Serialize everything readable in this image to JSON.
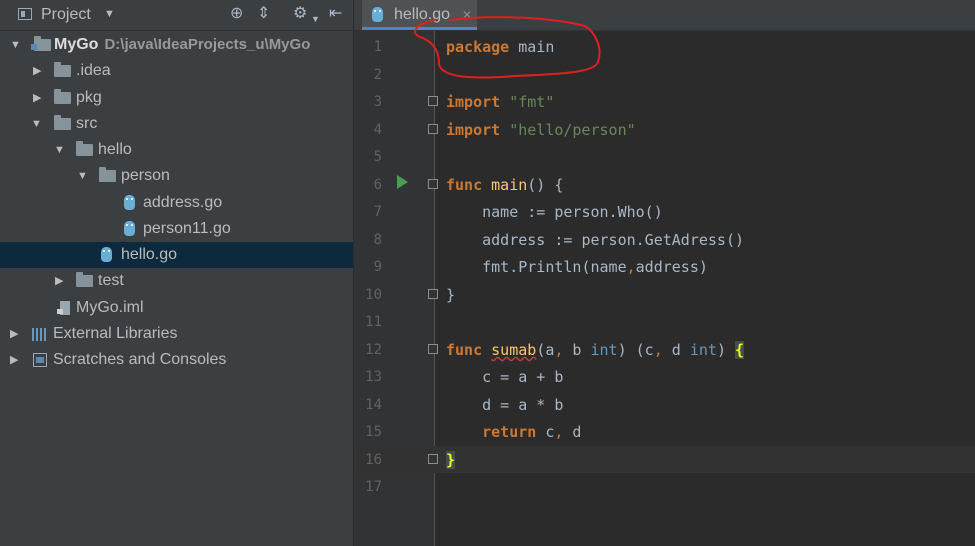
{
  "project_panel": {
    "title": "Project",
    "tree": [
      {
        "name": "MyGo",
        "path": "D:\\java\\IdeaProjects_u\\MyGo"
      },
      {
        "name": ".idea"
      },
      {
        "name": "pkg"
      },
      {
        "name": "src"
      },
      {
        "name": "hello"
      },
      {
        "name": "person"
      },
      {
        "name": "address.go"
      },
      {
        "name": "person11.go"
      },
      {
        "name": "hello.go"
      },
      {
        "name": "test"
      },
      {
        "name": "MyGo.iml"
      },
      {
        "name": "External Libraries"
      },
      {
        "name": "Scratches and Consoles"
      }
    ]
  },
  "editor": {
    "tab_label": "hello.go",
    "lines": [
      {
        "n": "1",
        "t": "package main"
      },
      {
        "n": "2",
        "t": ""
      },
      {
        "n": "3",
        "t": "import \"fmt\""
      },
      {
        "n": "4",
        "t": "import \"hello/person\""
      },
      {
        "n": "5",
        "t": ""
      },
      {
        "n": "6",
        "t": "func main() {"
      },
      {
        "n": "7",
        "t": "    name := person.Who()"
      },
      {
        "n": "8",
        "t": "    address := person.GetAdress()"
      },
      {
        "n": "9",
        "t": "    fmt.Println(name,address)"
      },
      {
        "n": "10",
        "t": "}"
      },
      {
        "n": "11",
        "t": ""
      },
      {
        "n": "12",
        "t": "func sumab(a, b int) (c, d int) {"
      },
      {
        "n": "13",
        "t": "    c = a + b"
      },
      {
        "n": "14",
        "t": "    d = a * b"
      },
      {
        "n": "15",
        "t": "    return c, d"
      },
      {
        "n": "16",
        "t": "}"
      },
      {
        "n": "17",
        "t": ""
      }
    ]
  },
  "colors": {
    "keyword": "#cc7832",
    "string": "#6a8759",
    "function": "#ffc66d",
    "type": "#6897bb",
    "annotation": "#e02020"
  }
}
